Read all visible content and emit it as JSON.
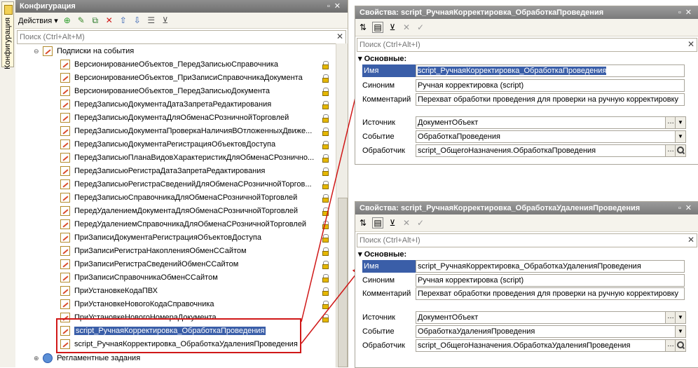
{
  "side_tab": {
    "label": "Конфигурация"
  },
  "config": {
    "title": "Конфигурация",
    "actions_label": "Действия ▾",
    "search_placeholder": "Поиск (Ctrl+Alt+M)",
    "tree": {
      "parent": "Подписки на события",
      "items": [
        "ВерсионированиеОбъектов_ПередЗаписьюСправочника",
        "ВерсионированиеОбъектов_ПриЗаписиСправочникаДокумента",
        "ВерсионированиеОбъектов_ПередЗаписьюДокумента",
        "ПередЗаписьюДокументаДатаЗапретаРедактирования",
        "ПередЗаписьюДокументаДляОбменаСРозничнойТорговлей",
        "ПередЗаписьюДокументаПроверкаНаличияВОтложенныхДвиже...",
        "ПередЗаписьюДокументаРегистрацияОбъектовДоступа",
        "ПередЗаписьюПланаВидовХарактеристикДляОбменаСРозничнo...",
        "ПередЗаписьюРегистраДатаЗапретаРедактирования",
        "ПередЗаписьюРегистраСведенийДляОбменаСРозничнойТоргов...",
        "ПередЗаписьюСправочникаДляОбменаСРозничнойТорговлей",
        "ПередУдалениемДокументаДляОбменаСРозничнойТорговлей",
        "ПередУдалениемСправочникаДляОбменаСРозничнойТорговлей",
        "ПриЗаписиДокументаРегистрацияОбъектовДоступа",
        "ПриЗаписиРегистраНакопленияОбменССайтом",
        "ПриЗаписиРегистраСведенийОбменССайтом",
        "ПриЗаписиСправочникаОбменССайтом",
        "ПриУстановкеКодаПВХ",
        "ПриУстановкеНовогоКодаСправочника",
        "ПриУстановкеНовогоНомераДокумента",
        "script_РучнаяКорректировка_ОбработкаПроведения",
        "script_РучнаяКорректировка_ОбработкаУдаленияПроведения"
      ],
      "bottom": "Регламентные задания"
    }
  },
  "prop1": {
    "title": "Свойства: script_РучнаяКорректировка_ОбработкаПроведения",
    "search_placeholder": "Поиск (Ctrl+Alt+I)",
    "section": "Основные:",
    "labels": {
      "name": "Имя",
      "synonym": "Синоним",
      "comment": "Комментарий",
      "source": "Источник",
      "event": "Событие",
      "handler": "Обработчик"
    },
    "values": {
      "name": "script_РучнаяКорректировка_ОбработкаПроведения",
      "synonym": "Ручная корректировка (script)",
      "comment": "Перехват обработки проведения для проверки на ручную корректировку",
      "source": "ДокументОбъект",
      "event": "ОбработкаПроведения",
      "handler": "script_ОбщегоНазначения.ОбработкаПроведения"
    }
  },
  "prop2": {
    "title": "Свойства: script_РучнаяКорректировка_ОбработкаУдаленияПроведения",
    "search_placeholder": "Поиск (Ctrl+Alt+I)",
    "section": "Основные:",
    "labels": {
      "name": "Имя",
      "synonym": "Синоним",
      "comment": "Комментарий",
      "source": "Источник",
      "event": "Событие",
      "handler": "Обработчик"
    },
    "values": {
      "name": "script_РучнаяКорректировка_ОбработкаУдаленияПроведения",
      "synonym": "Ручная корректировка (script)",
      "comment": "Перехват обработки проведения для проверки на ручную корректировку",
      "source": "ДокументОбъект",
      "event": "ОбработкаУдаленияПроведения",
      "handler": "script_ОбщегоНазначения.ОбработкаУдаленияПроведения"
    }
  },
  "colors": {
    "selection": "#3a5ea8",
    "annotation": "#d01818"
  }
}
